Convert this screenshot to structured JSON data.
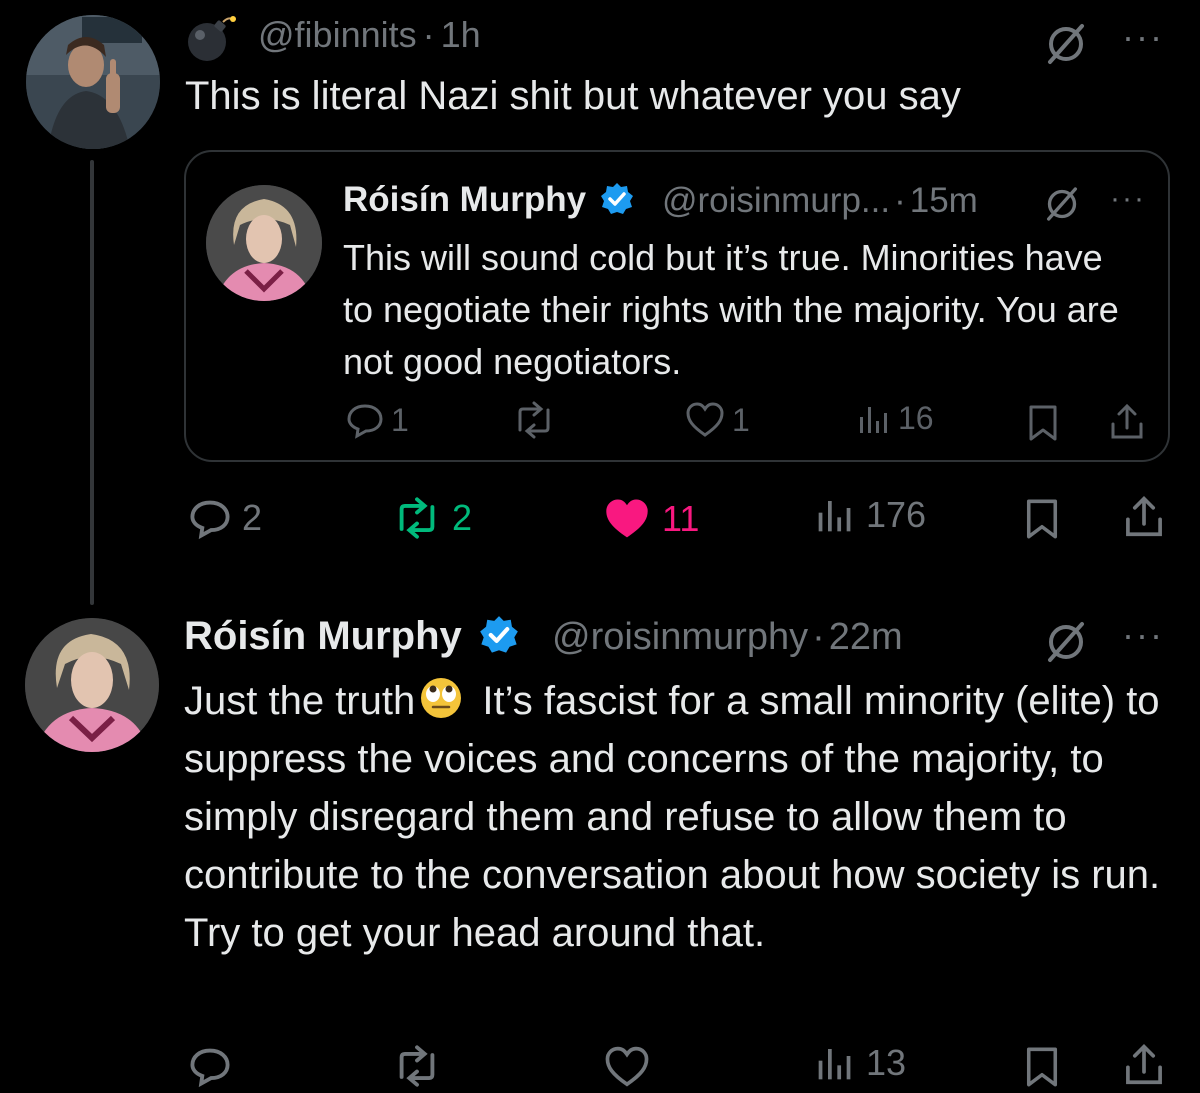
{
  "thread": {
    "reply": {
      "handle": "@fibinnits",
      "time": "1h",
      "body": "This is literal Nazi shit but whatever you say",
      "more": "···",
      "stats": {
        "replies": "2",
        "reposts": "2",
        "likes": "11",
        "views": "176"
      },
      "colors": {
        "repost": "#00ba7c",
        "like": "#f91880"
      }
    },
    "quoted": {
      "name": "Róisín Murphy",
      "handle": "@roisinmurp...",
      "time": "15m",
      "body": "This will sound cold but it’s true. Minorities have to negotiate their rights with the majority. You are not good negotiators.",
      "more": "···",
      "stats": {
        "replies": "1",
        "likes": "1",
        "views": "16"
      }
    },
    "response": {
      "name": "Róisín Murphy",
      "handle": "@roisinmurphy",
      "time": "22m",
      "body_before_emoji": "Just the truth",
      "body_after_emoji": " It’s fascist for a small minority (elite) to suppress the voices and concerns of the majority, to simply disregard them and refuse to allow them to contribute to the conversation about how society is run. Try to get your head around that.",
      "more": "···",
      "stats": {
        "views": "13"
      }
    },
    "separator": "·",
    "verified_color": "#1d9bf0"
  }
}
